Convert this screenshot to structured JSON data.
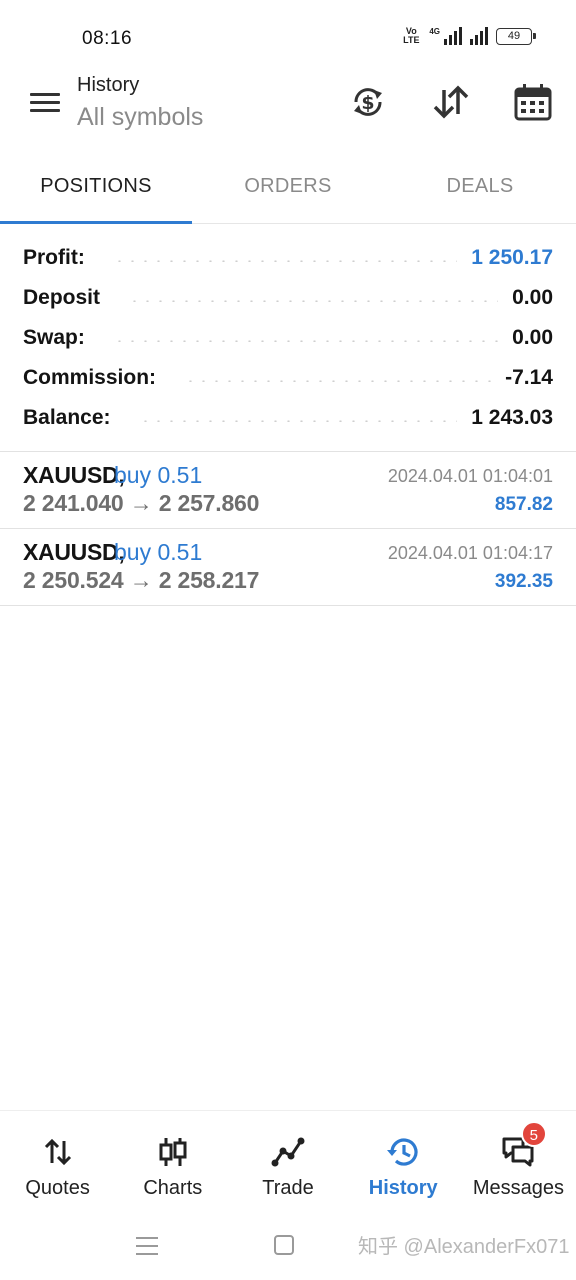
{
  "status_bar": {
    "time": "08:16",
    "volte": "Vo LTE",
    "network": "4G",
    "battery": "49"
  },
  "header": {
    "title": "History",
    "subtitle": "All symbols",
    "icons": [
      "menu-icon",
      "currency-exchange-icon",
      "sort-icon",
      "calendar-icon"
    ]
  },
  "tabs": [
    {
      "label": "POSITIONS",
      "active": true
    },
    {
      "label": "ORDERS",
      "active": false
    },
    {
      "label": "DEALS",
      "active": false
    }
  ],
  "summary": [
    {
      "label": "Profit:",
      "value": "1 250.17"
    },
    {
      "label": "Deposit",
      "value": "0.00"
    },
    {
      "label": "Swap:",
      "value": "0.00"
    },
    {
      "label": "Commission:",
      "value": "-7.14"
    },
    {
      "label": "Balance:",
      "value": "1 243.03"
    }
  ],
  "positions": [
    {
      "symbol": "XAUUSD,",
      "direction": "buy 0.51",
      "prices": "2 241.040 → 2 257.860",
      "time": "2024.04.01 01:04:01",
      "profit": "857.82"
    },
    {
      "symbol": "XAUUSD,",
      "direction": "buy 0.51",
      "prices": "2 250.524 → 2 258.217",
      "time": "2024.04.01 01:04:17",
      "profit": "392.35"
    }
  ],
  "bottom_nav": [
    {
      "label": "Quotes",
      "icon": "quotes-icon"
    },
    {
      "label": "Charts",
      "icon": "charts-icon"
    },
    {
      "label": "Trade",
      "icon": "trade-icon"
    },
    {
      "label": "History",
      "icon": "history-icon",
      "active": true
    },
    {
      "label": "Messages",
      "icon": "messages-icon",
      "badge": "5"
    }
  ],
  "watermark": "知乎 @AlexanderFx071",
  "colors": {
    "accent": "#2e7bd1",
    "badge": "#e2453c"
  }
}
